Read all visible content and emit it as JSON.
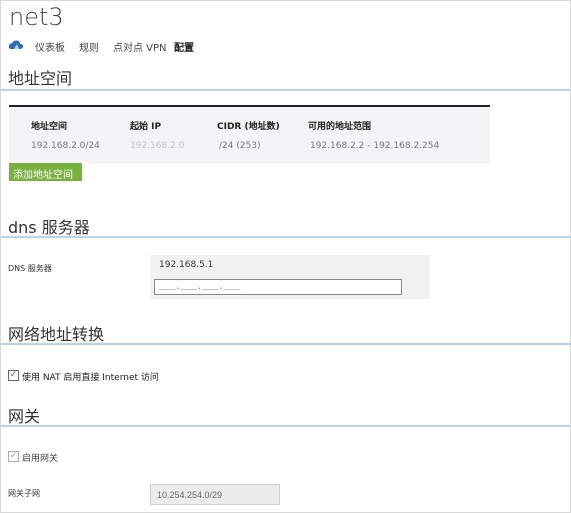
{
  "page_title": "net3",
  "nav": {
    "items": [
      {
        "label": "仪表板",
        "active": false
      },
      {
        "label": "规则",
        "active": false
      },
      {
        "label": "点对点 VPN",
        "active": false
      },
      {
        "label": "配置",
        "active": true
      }
    ]
  },
  "address_space": {
    "title": "地址空间",
    "columns": [
      "地址空间",
      "起始 IP",
      "CIDR (地址数)",
      "可用的地址范围"
    ],
    "rows": [
      [
        "192.168.2.0/24",
        "192.168.2.0",
        "/24 (253)",
        "192.168.2.2 - 192.168.2.254"
      ]
    ],
    "add_button": "添加地址空间"
  },
  "dns": {
    "title": "dns 服务器",
    "label": "DNS 服务器",
    "servers": [
      "192.168.5.1"
    ],
    "new_entry_value": "___.___.___.___"
  },
  "nat": {
    "title": "网络地址转换",
    "checkbox_label": "使用 NAT 启用直接 Internet 访问",
    "checked": true
  },
  "gateway": {
    "title": "网关",
    "checkbox_label": "启用网关",
    "checked": true,
    "subnet_label": "网关子网",
    "subnet_value": "10.254.254.0/29"
  },
  "colors": {
    "accent_green": "#7ab040",
    "section_rule": "#b9d4ea",
    "check_blue": "#2a6eb8"
  }
}
